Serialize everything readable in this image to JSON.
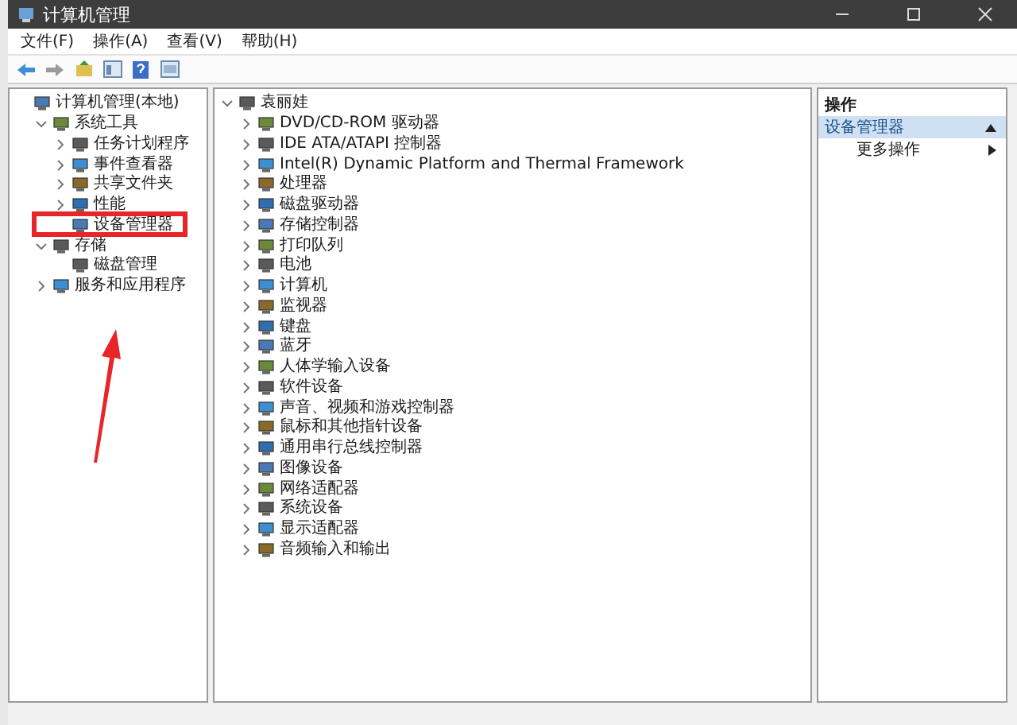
{
  "window": {
    "title": "计算机管理"
  },
  "menu": [
    {
      "label": "文件(F)"
    },
    {
      "label": "操作(A)"
    },
    {
      "label": "查看(V)"
    },
    {
      "label": "帮助(H)"
    }
  ],
  "left_tree": [
    {
      "label": "计算机管理(本地)",
      "children": [
        {
          "label": "系统工具",
          "expanded": true,
          "children": [
            {
              "label": "任务计划程序",
              "expanded": false
            },
            {
              "label": "事件查看器",
              "expanded": false
            },
            {
              "label": "共享文件夹",
              "expanded": false
            },
            {
              "label": "性能",
              "expanded": false
            },
            {
              "label": "设备管理器",
              "annotated": true
            }
          ]
        },
        {
          "label": "存储",
          "expanded": true,
          "children": [
            {
              "label": "磁盘管理"
            }
          ]
        },
        {
          "label": "服务和应用程序",
          "expanded": false
        }
      ]
    }
  ],
  "device_tree": {
    "label": "袁丽娃",
    "expanded": true,
    "children": [
      {
        "label": "DVD/CD-ROM 驱动器",
        "expanded": false
      },
      {
        "label": "IDE ATA/ATAPI 控制器",
        "expanded": false
      },
      {
        "label": "Intel(R) Dynamic Platform and Thermal Framework",
        "expanded": false
      },
      {
        "label": "处理器",
        "expanded": false
      },
      {
        "label": "磁盘驱动器",
        "expanded": false
      },
      {
        "label": "存储控制器",
        "expanded": false
      },
      {
        "label": "打印队列",
        "expanded": false
      },
      {
        "label": "电池",
        "expanded": false
      },
      {
        "label": "计算机",
        "expanded": false
      },
      {
        "label": "监视器",
        "expanded": false
      },
      {
        "label": "键盘",
        "expanded": false
      },
      {
        "label": "蓝牙",
        "expanded": false
      },
      {
        "label": "人体学输入设备",
        "expanded": false
      },
      {
        "label": "软件设备",
        "expanded": false
      },
      {
        "label": "声音、视频和游戏控制器",
        "expanded": false
      },
      {
        "label": "鼠标和其他指针设备",
        "expanded": false
      },
      {
        "label": "通用串行总线控制器",
        "expanded": false
      },
      {
        "label": "图像设备",
        "expanded": false
      },
      {
        "label": "网络适配器",
        "expanded": false
      },
      {
        "label": "系统设备",
        "expanded": false
      },
      {
        "label": "显示适配器",
        "expanded": false
      },
      {
        "label": "音频输入和输出",
        "expanded": false
      }
    ]
  },
  "actions": {
    "title": "操作",
    "section": {
      "label": "设备管理器",
      "expanded": true
    },
    "items": [
      {
        "label": "更多操作"
      }
    ]
  }
}
